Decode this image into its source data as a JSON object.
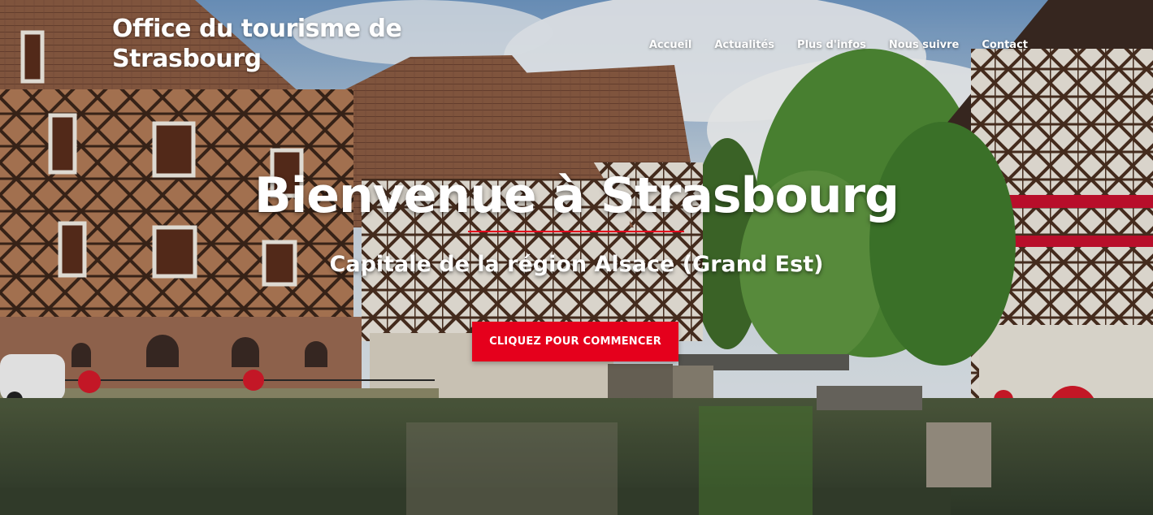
{
  "header": {
    "brand_title": "Office du tourisme de Strasbourg"
  },
  "nav": {
    "items": [
      {
        "label": "Accueil"
      },
      {
        "label": "Actualités"
      },
      {
        "label": "Plus d'infos"
      },
      {
        "label": "Nous suivre"
      },
      {
        "label": "Contact"
      }
    ]
  },
  "hero": {
    "headline": "Bienvenue à Strasbourg",
    "subheadline": "Capitale de la région Alsace (Grand Est)",
    "cta_label": "CLIQUEZ POUR COMMENCER",
    "background_image": "strasbourg-petite-france-canal-photo"
  },
  "colors": {
    "accent": "#e5001c",
    "text": "#ffffff"
  }
}
